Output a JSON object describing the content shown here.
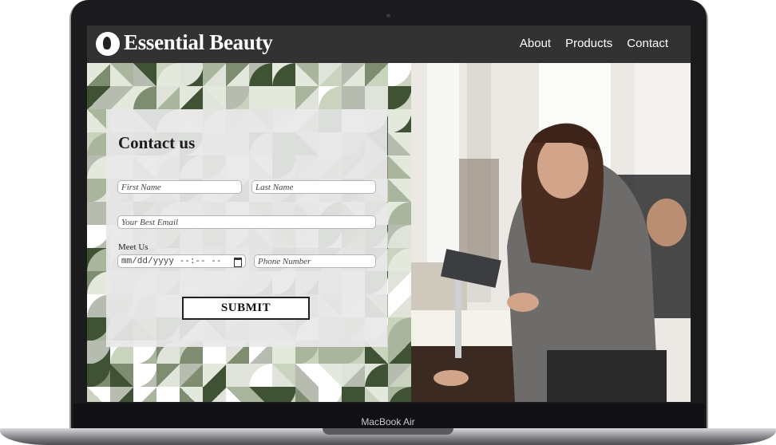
{
  "site": {
    "title": "Essential Beauty",
    "nav": [
      "About",
      "Products",
      "Contact"
    ]
  },
  "form": {
    "heading": "Contact us",
    "first_name_placeholder": "First Name",
    "last_name_placeholder": "Last Name",
    "email_placeholder": "Your Best Email",
    "meet_label": "Meet Us",
    "date_value": "mm/dd/yyyy --:-- --",
    "phone_placeholder": "Phone Number",
    "submit_label": "SUBMIT"
  },
  "device": {
    "brand": "MacBook Air"
  },
  "colors": {
    "header": "#333232",
    "accent_green": "#3f5233",
    "card": "#e8e8e8"
  }
}
